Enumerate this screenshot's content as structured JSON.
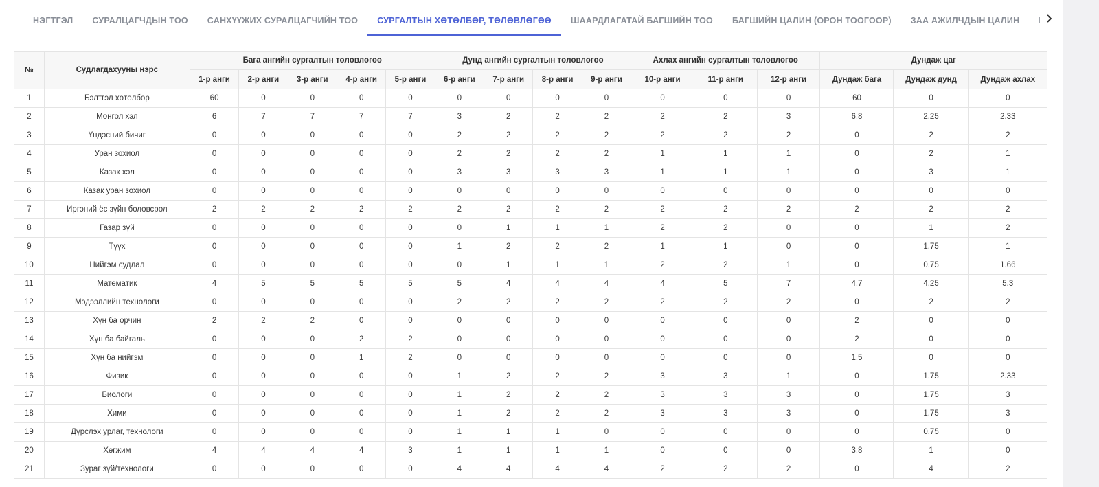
{
  "tabs": {
    "items": [
      {
        "label": "НЭГТГЭЛ"
      },
      {
        "label": "СУРАЛЦАГЧДЫН ТОО"
      },
      {
        "label": "САНХҮҮЖИХ СУРАЛЦАГЧИЙН ТОО"
      },
      {
        "label": "СУРГАЛТЫН ХӨТӨЛБӨР, ТӨЛӨВЛӨГӨӨ"
      },
      {
        "label": "ШААРДЛАГАТАЙ БАГШИЙН ТОО"
      },
      {
        "label": "БАГШИЙН ЦАЛИН (ОРОН ТООГООР)"
      },
      {
        "label": "ЗАА АЖИЛЧДЫН ЦАЛИН"
      },
      {
        "label": "БАГШИЙН ЦАЛИН (ХИЧЭЭЛИЙН ЦАГААР)"
      }
    ],
    "active_index": 3,
    "next_icon": "chevron-right-icon"
  },
  "table": {
    "header": {
      "num": "№",
      "subject": "Судлагдахууны нэрс",
      "groups": [
        {
          "label": "Бага ангийн сургалтын төлөвлөгөө"
        },
        {
          "label": "Дунд ангийн сургалтын төлөвлөгөө"
        },
        {
          "label": "Ахлах ангийн сургалтын төлөвлөгөө"
        },
        {
          "label": "Дундаж цаг"
        }
      ],
      "columns": [
        "1-р анги",
        "2-р анги",
        "3-р анги",
        "4-р анги",
        "5-р анги",
        "6-р анги",
        "7-р анги",
        "8-р анги",
        "9-р анги",
        "10-р анги",
        "11-р анги",
        "12-р анги",
        "Дундаж бага",
        "Дундаж дунд",
        "Дундаж ахлах"
      ]
    },
    "rows": [
      {
        "num": "1",
        "name": "Бэлтгэл хөтөлбөр",
        "values": [
          "60",
          "0",
          "0",
          "0",
          "0",
          "0",
          "0",
          "0",
          "0",
          "0",
          "0",
          "0",
          "60",
          "0",
          "0"
        ]
      },
      {
        "num": "2",
        "name": "Монгол хэл",
        "values": [
          "6",
          "7",
          "7",
          "7",
          "7",
          "3",
          "2",
          "2",
          "2",
          "2",
          "2",
          "3",
          "6.8",
          "2.25",
          "2.33"
        ]
      },
      {
        "num": "3",
        "name": "Үндэсний бичиг",
        "values": [
          "0",
          "0",
          "0",
          "0",
          "0",
          "2",
          "2",
          "2",
          "2",
          "2",
          "2",
          "2",
          "0",
          "2",
          "2"
        ]
      },
      {
        "num": "4",
        "name": "Уран зохиол",
        "values": [
          "0",
          "0",
          "0",
          "0",
          "0",
          "2",
          "2",
          "2",
          "2",
          "1",
          "1",
          "1",
          "0",
          "2",
          "1"
        ]
      },
      {
        "num": "5",
        "name": "Казак хэл",
        "values": [
          "0",
          "0",
          "0",
          "0",
          "0",
          "3",
          "3",
          "3",
          "3",
          "1",
          "1",
          "1",
          "0",
          "3",
          "1"
        ]
      },
      {
        "num": "6",
        "name": "Казак уран зохиол",
        "values": [
          "0",
          "0",
          "0",
          "0",
          "0",
          "0",
          "0",
          "0",
          "0",
          "0",
          "0",
          "0",
          "0",
          "0",
          "0"
        ]
      },
      {
        "num": "7",
        "name": "Иргэний ёс зүйн боловсрол",
        "values": [
          "2",
          "2",
          "2",
          "2",
          "2",
          "2",
          "2",
          "2",
          "2",
          "2",
          "2",
          "2",
          "2",
          "2",
          "2"
        ]
      },
      {
        "num": "8",
        "name": "Газар зүй",
        "values": [
          "0",
          "0",
          "0",
          "0",
          "0",
          "0",
          "1",
          "1",
          "1",
          "2",
          "2",
          "0",
          "0",
          "1",
          "2"
        ]
      },
      {
        "num": "9",
        "name": "Түүх",
        "values": [
          "0",
          "0",
          "0",
          "0",
          "0",
          "1",
          "2",
          "2",
          "2",
          "1",
          "1",
          "0",
          "0",
          "1.75",
          "1"
        ]
      },
      {
        "num": "10",
        "name": "Нийгэм судлал",
        "values": [
          "0",
          "0",
          "0",
          "0",
          "0",
          "0",
          "1",
          "1",
          "1",
          "2",
          "2",
          "1",
          "0",
          "0.75",
          "1.66"
        ]
      },
      {
        "num": "11",
        "name": "Математик",
        "values": [
          "4",
          "5",
          "5",
          "5",
          "5",
          "5",
          "4",
          "4",
          "4",
          "4",
          "5",
          "7",
          "4.7",
          "4.25",
          "5.3"
        ]
      },
      {
        "num": "12",
        "name": "Мэдээллийн технологи",
        "values": [
          "0",
          "0",
          "0",
          "0",
          "0",
          "2",
          "2",
          "2",
          "2",
          "2",
          "2",
          "2",
          "0",
          "2",
          "2"
        ]
      },
      {
        "num": "13",
        "name": "Хүн ба орчин",
        "values": [
          "2",
          "2",
          "2",
          "0",
          "0",
          "0",
          "0",
          "0",
          "0",
          "0",
          "0",
          "0",
          "2",
          "0",
          "0"
        ]
      },
      {
        "num": "14",
        "name": "Хүн ба байгаль",
        "values": [
          "0",
          "0",
          "0",
          "2",
          "2",
          "0",
          "0",
          "0",
          "0",
          "0",
          "0",
          "0",
          "2",
          "0",
          "0"
        ]
      },
      {
        "num": "15",
        "name": "Хүн ба нийгэм",
        "values": [
          "0",
          "0",
          "0",
          "1",
          "2",
          "0",
          "0",
          "0",
          "0",
          "0",
          "0",
          "0",
          "1.5",
          "0",
          "0"
        ]
      },
      {
        "num": "16",
        "name": "Физик",
        "values": [
          "0",
          "0",
          "0",
          "0",
          "0",
          "1",
          "2",
          "2",
          "2",
          "3",
          "3",
          "1",
          "0",
          "1.75",
          "2.33"
        ]
      },
      {
        "num": "17",
        "name": "Биологи",
        "values": [
          "0",
          "0",
          "0",
          "0",
          "0",
          "1",
          "2",
          "2",
          "2",
          "3",
          "3",
          "3",
          "0",
          "1.75",
          "3"
        ]
      },
      {
        "num": "18",
        "name": "Хими",
        "values": [
          "0",
          "0",
          "0",
          "0",
          "0",
          "1",
          "2",
          "2",
          "2",
          "3",
          "3",
          "3",
          "0",
          "1.75",
          "3"
        ]
      },
      {
        "num": "19",
        "name": "Дүрслэх урлаг, технологи",
        "values": [
          "0",
          "0",
          "0",
          "0",
          "0",
          "1",
          "1",
          "1",
          "0",
          "0",
          "0",
          "0",
          "0",
          "0.75",
          "0"
        ]
      },
      {
        "num": "20",
        "name": "Хөгжим",
        "values": [
          "4",
          "4",
          "4",
          "4",
          "3",
          "1",
          "1",
          "1",
          "1",
          "0",
          "0",
          "0",
          "3.8",
          "1",
          "0"
        ]
      },
      {
        "num": "21",
        "name": "Зураг зүй/технологи",
        "values": [
          "0",
          "0",
          "0",
          "0",
          "0",
          "4",
          "4",
          "4",
          "4",
          "2",
          "2",
          "2",
          "0",
          "4",
          "2"
        ]
      }
    ]
  },
  "colors": {
    "accent": "#4e63d6",
    "tab_text": "#8a8f98",
    "header_bg": "#f7f7f7",
    "border": "#e4e4e4"
  }
}
